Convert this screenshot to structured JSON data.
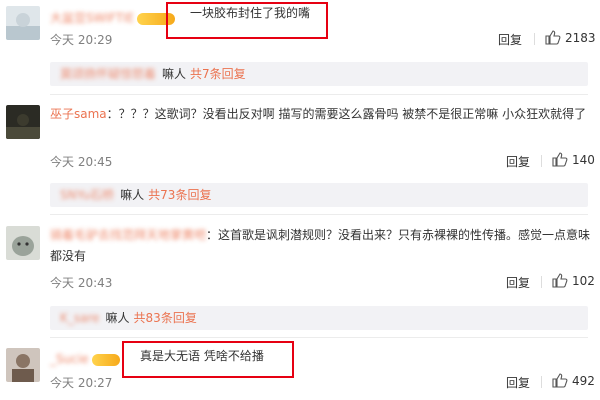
{
  "comments": [
    {
      "username": "大盆豆SWIFTIE",
      "text": "一块胶布封住了我的嘴",
      "time": "今天 20:29",
      "reply": "回复",
      "likes": "2183",
      "sub": {
        "name": "莫颂扬怀疑惊怒着",
        "dots": "嘛人",
        "link": "共7条回复"
      }
    },
    {
      "username": "巫子sama",
      "text": "：？？？这歌词？没看出反对啊  描写的需要这么露骨吗 被禁不是很正常嘛 小众狂欢就得了",
      "time": "今天 20:45",
      "reply": "回复",
      "likes": "140",
      "sub": {
        "name": "SNYu石桥",
        "dots": "嘛人",
        "link": "共73条回复"
      }
    },
    {
      "username": "骑着毛驴去找范拜天地掌黄吧",
      "text": "：这首歌是讽刺潜规则？没看出来？只有赤裸裸的性传播。感觉一点意味都没有",
      "time": "今天 20:43",
      "reply": "回复",
      "likes": "102",
      "sub": {
        "name": "K_sare",
        "dots": "嘛人",
        "link": "共83条回复"
      }
    },
    {
      "username": "_Sucie",
      "text": "真是大无语 凭啥不给播",
      "time": "今天 20:27",
      "reply": "回复",
      "likes": "492"
    }
  ]
}
